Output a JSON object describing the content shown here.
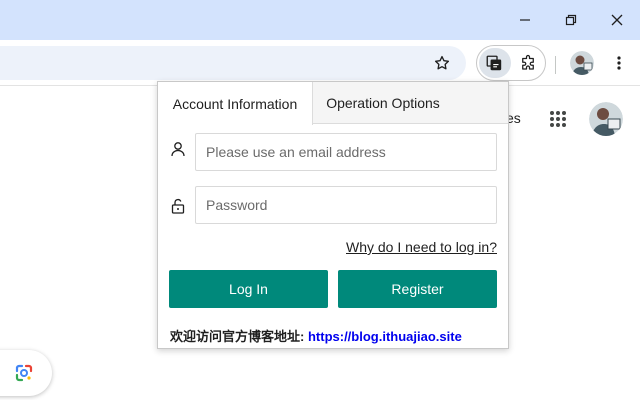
{
  "browser": {
    "window_controls": [
      "minimize",
      "restore",
      "close"
    ],
    "toolbar_icons": [
      "bookmark-star-icon",
      "extension-active-icon",
      "extensions-puzzle-icon",
      "profile-avatar",
      "menu-kebab-icon"
    ]
  },
  "page": {
    "partial_text": "es"
  },
  "popup": {
    "tabs": [
      {
        "label": "Account Information",
        "active": true
      },
      {
        "label": "Operation Options",
        "active": false
      }
    ],
    "email": {
      "placeholder": "Please use an email address",
      "value": ""
    },
    "password": {
      "placeholder": "Password",
      "value": ""
    },
    "help_link": "Why do I need to log in?",
    "login_button": "Log In",
    "register_button": "Register",
    "footer": {
      "label": "欢迎访问官方博客地址:",
      "url": "https://blog.ithuajiao.site"
    }
  },
  "colors": {
    "accent": "#00897b",
    "titlebar": "#d3e3fd",
    "link": "#0000ee"
  }
}
